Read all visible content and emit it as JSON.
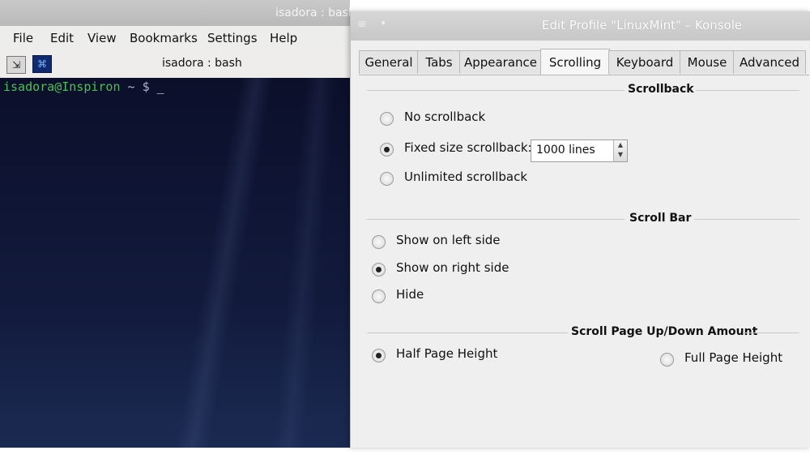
{
  "terminal": {
    "window_title": "isadora : bash",
    "menu": [
      "File",
      "Edit",
      "View",
      "Bookmarks",
      "Settings",
      "Help"
    ],
    "tab_title": "isadora : bash",
    "prompt_user": "isadora@Inspiron",
    "prompt_rest": " ~ $ ",
    "cursor": "_",
    "icons": [
      "new-tab-icon",
      "konsole-icon"
    ]
  },
  "dialog": {
    "title": "Edit Profile \"LinuxMint\" – Konsole",
    "tabs": [
      "General",
      "Tabs",
      "Appearance",
      "Scrolling",
      "Keyboard",
      "Mouse",
      "Advanced"
    ],
    "active_tab": "Scrolling",
    "scrollback": {
      "title": "Scrollback",
      "options": [
        {
          "label": "No scrollback",
          "checked": false
        },
        {
          "label": "Fixed size scrollback:",
          "checked": true
        },
        {
          "label": "Unlimited scrollback",
          "checked": false
        }
      ],
      "lines_value": "1000 lines"
    },
    "scrollbar": {
      "title": "Scroll Bar",
      "options": [
        {
          "label": "Show on left side",
          "checked": false
        },
        {
          "label": "Show on right side",
          "checked": true
        },
        {
          "label": "Hide",
          "checked": false
        }
      ]
    },
    "page_amount": {
      "title": "Scroll Page Up/Down Amount",
      "options": [
        {
          "label": "Half Page Height",
          "checked": true
        },
        {
          "label": "Full Page Height",
          "checked": false
        }
      ]
    }
  }
}
